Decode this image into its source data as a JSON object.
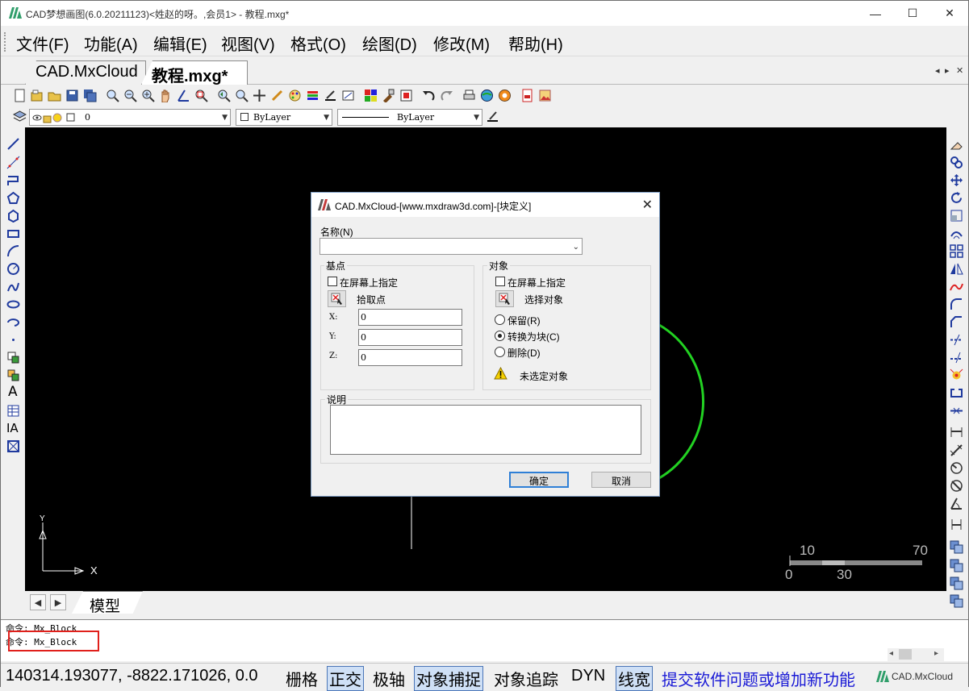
{
  "window": {
    "title": "CAD梦想画图(6.0.20211123)<姓赵的呀。,会员1> - 教程.mxg*",
    "minimize": "—",
    "maximize": "☐",
    "close": "✕"
  },
  "menu": [
    {
      "label": "文件(F)"
    },
    {
      "label": "功能(A)"
    },
    {
      "label": "编辑(E)"
    },
    {
      "label": "视图(V)"
    },
    {
      "label": "格式(O)"
    },
    {
      "label": "绘图(D)"
    },
    {
      "label": "修改(M)"
    },
    {
      "label": "帮助(H)"
    }
  ],
  "tabs": [
    {
      "label": "CAD.MxCloud",
      "active": false
    },
    {
      "label": "教程.mxg*",
      "active": true
    }
  ],
  "tab_nav": {
    "left": "◂",
    "right": "▸",
    "close": "✕"
  },
  "layer_bar": {
    "layer_value": "0",
    "color_value": "ByLayer",
    "linetype_value": "ByLayer"
  },
  "canvas": {
    "background": "#000000",
    "axis_y": "Y",
    "axis_x": "X",
    "scale_labels": {
      "top_left": "10",
      "top_right": "70",
      "bottom_left": "0",
      "bottom_mid": "30"
    },
    "arc_color": "#22d122"
  },
  "model_tabs": {
    "prev": "◀",
    "next": "▶",
    "model": "模型"
  },
  "command": {
    "lines": [
      "命令: Mx_Block",
      "命令: Mx_Block"
    ]
  },
  "status": {
    "coords": "140314.193077,  -8822.171026,  0.0",
    "items": [
      {
        "label": "栅格",
        "on": false
      },
      {
        "label": "正交",
        "on": true
      },
      {
        "label": "极轴",
        "on": false
      },
      {
        "label": "对象捕捉",
        "on": true
      },
      {
        "label": "对象追踪",
        "on": false
      },
      {
        "label": "DYN",
        "on": false
      },
      {
        "label": "线宽",
        "on": true
      }
    ],
    "feedback_link": "提交软件问题或增加新功能",
    "brand": "CAD.MxCloud"
  },
  "dialog": {
    "title": "CAD.MxCloud-[www.mxdraw3d.com]-[块定义]",
    "close": "✕",
    "name_label": "名称(N)",
    "name_value": "",
    "basepoint": {
      "group_title": "基点",
      "on_screen": "在屏幕上指定",
      "pick_point": "拾取点",
      "x_label": "X:",
      "y_label": "Y:",
      "z_label": "Z:",
      "x_value": "0",
      "y_value": "0",
      "z_value": "0"
    },
    "objects": {
      "group_title": "对象",
      "on_screen": "在屏幕上指定",
      "select_objects": "选择对象",
      "retain": "保留(R)",
      "convert": "转换为块(C)",
      "delete": "删除(D)",
      "selected_option": "convert",
      "warning": "未选定对象"
    },
    "description": {
      "group_title": "说明",
      "value": ""
    },
    "ok": "确定",
    "cancel": "取消"
  }
}
